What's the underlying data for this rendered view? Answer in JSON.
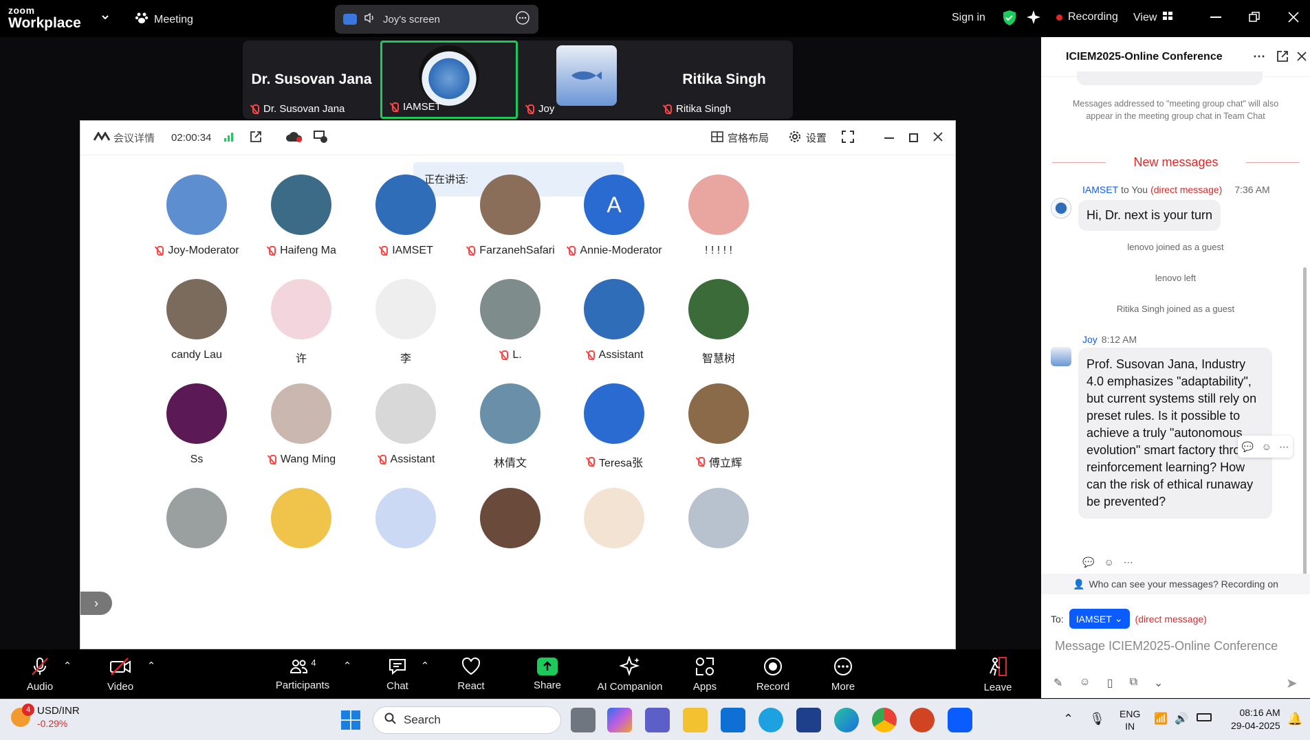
{
  "topbar": {
    "logo_small": "zoom",
    "logo_big": "Workplace",
    "meeting": "Meeting",
    "share_label": "Joy's screen",
    "sign_in": "Sign in",
    "recording": "Recording",
    "view": "View"
  },
  "strip": {
    "tile1_name": "Dr. Susovan Jana",
    "tile1_foot": "Dr. Susovan Jana",
    "tile2_foot": "IAMSET",
    "tile3_foot": "Joy",
    "tile4_name": "Ritika Singh",
    "tile4_foot": "Ritika Singh"
  },
  "shared": {
    "details": "会议详情",
    "timer": "02:00:34",
    "layout": "宫格布局",
    "settings": "设置",
    "speaking": "正在讲话:"
  },
  "participants": [
    {
      "name": "Joy-Moderator",
      "muted": true,
      "color": "#5d8fd0"
    },
    {
      "name": "Haifeng Ma",
      "muted": true,
      "color": "#3b6b86"
    },
    {
      "name": "IAMSET",
      "muted": true,
      "color": "#2f6db8"
    },
    {
      "name": "FarzanehSafari",
      "muted": true,
      "color": "#8b6e5a"
    },
    {
      "name": "Annie-Moderator",
      "muted": true,
      "color": "#2a6bd1",
      "initial": "A"
    },
    {
      "name": "! ! ! ! !",
      "muted": false,
      "color": "#e9a5a0"
    },
    {
      "name": "candy Lau",
      "muted": false,
      "color": "#7a6b5c"
    },
    {
      "name": "许",
      "muted": false,
      "color": "#f3d6dd"
    },
    {
      "name": "李",
      "muted": false,
      "color": "#eeeeee"
    },
    {
      "name": "L.",
      "muted": true,
      "color": "#7f8c8c"
    },
    {
      "name": "Assistant",
      "muted": true,
      "color": "#2f6db8"
    },
    {
      "name": "智慧树",
      "muted": false,
      "color": "#3c6b3a"
    },
    {
      "name": "Ss",
      "muted": false,
      "color": "#5b1a55"
    },
    {
      "name": "Wang Ming",
      "muted": true,
      "color": "#c9b7b0"
    },
    {
      "name": "Assistant",
      "muted": true,
      "color": "#d8d8d8"
    },
    {
      "name": "林倩文",
      "muted": false,
      "color": "#6a8fa8"
    },
    {
      "name": "Teresa张",
      "muted": true,
      "color": "#2a6bd1"
    },
    {
      "name": "傅立辉",
      "muted": true,
      "color": "#8b6a4a"
    },
    {
      "name": "",
      "muted": false,
      "color": "#9aa0a0"
    },
    {
      "name": "",
      "muted": false,
      "color": "#f0c34a"
    },
    {
      "name": "",
      "muted": false,
      "color": "#cbd9f5"
    },
    {
      "name": "",
      "muted": false,
      "color": "#6a4a3a"
    },
    {
      "name": "",
      "muted": false,
      "color": "#f3e3d3"
    },
    {
      "name": "",
      "muted": false,
      "color": "#b8c2cf"
    }
  ],
  "chat": {
    "title": "ICIEM2025-Online Conference",
    "note": "Messages addressed to \"meeting group chat\" will also appear in the meeting group chat in Team Chat",
    "new_messages": "New messages",
    "msg1_from": "IAMSET",
    "msg1_to": "to You",
    "msg1_dm": "(direct message)",
    "msg1_time": "7:36 AM",
    "msg1_text": "Hi, Dr. next is your turn",
    "sys1": "lenovo joined as a guest",
    "sys2": "lenovo left",
    "sys3": "Ritika Singh joined as a guest",
    "msg2_from": "Joy",
    "msg2_time": "8:12 AM",
    "msg2_text": "Prof. Susovan Jana, Industry 4.0 emphasizes \"adaptability\", but current systems still rely on preset rules. Is it possible to achieve a truly \"autonomous evolution\" smart factory through reinforcement learning? How can the risk of ethical runaway be prevented?",
    "who_can_see": "Who can see your messages? Recording on",
    "to_label": "To:",
    "to_value": "IAMSET",
    "to_dm": "(direct message)",
    "placeholder": "Message ICIEM2025-Online Conference"
  },
  "toolbar": {
    "audio": "Audio",
    "video": "Video",
    "participants": "Participants",
    "participants_count": "4",
    "chat": "Chat",
    "react": "React",
    "share": "Share",
    "ai": "AI Companion",
    "apps": "Apps",
    "record": "Record",
    "more": "More",
    "leave": "Leave"
  },
  "taskbar": {
    "stock_name": "USD/INR",
    "stock_change": "-0.29%",
    "badge": "4",
    "search": "Search",
    "lang": "ENG",
    "region": "IN",
    "time": "08:16 AM",
    "date": "29-04-2025"
  },
  "colors": {
    "accent": "#0b5cff",
    "share_green": "#1ec95b",
    "rec_red": "#e02828",
    "dm_red": "#e02828"
  }
}
